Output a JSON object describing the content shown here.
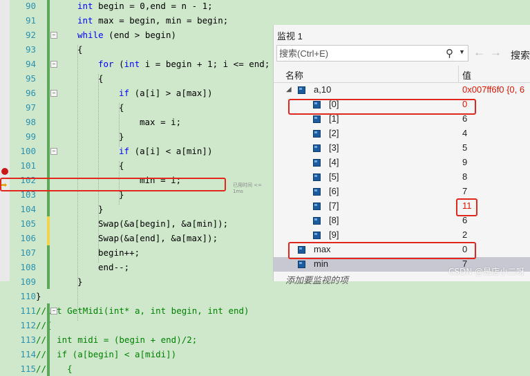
{
  "editor": {
    "lines": [
      {
        "num": "90",
        "parts": [
          [
            "kw",
            "int"
          ],
          [
            "pl",
            " begin = 0,end = n - 1;"
          ]
        ]
      },
      {
        "num": "91",
        "parts": [
          [
            "kw",
            "int"
          ],
          [
            "pl",
            " max = begin, min = begin;"
          ]
        ]
      },
      {
        "num": "92",
        "parts": [
          [
            "kw",
            "while"
          ],
          [
            "pl",
            " (end > begin)"
          ]
        ]
      },
      {
        "num": "93",
        "parts": [
          [
            "pl",
            "{"
          ]
        ]
      },
      {
        "num": "94",
        "parts": [
          [
            "kw",
            "for"
          ],
          [
            "pl",
            " ("
          ],
          [
            "kw",
            "int"
          ],
          [
            "pl",
            " i = begin + 1; i <= end;"
          ]
        ]
      },
      {
        "num": "95",
        "parts": [
          [
            "pl",
            "{"
          ]
        ]
      },
      {
        "num": "96",
        "parts": [
          [
            "kw",
            "if"
          ],
          [
            "pl",
            " (a[i] > a[max])"
          ]
        ]
      },
      {
        "num": "97",
        "parts": [
          [
            "pl",
            "{"
          ]
        ]
      },
      {
        "num": "98",
        "parts": [
          [
            "pl",
            "max = i;"
          ]
        ]
      },
      {
        "num": "99",
        "parts": [
          [
            "pl",
            "}"
          ]
        ]
      },
      {
        "num": "100",
        "parts": [
          [
            "kw",
            "if"
          ],
          [
            "pl",
            " (a[i] < a[min])"
          ]
        ]
      },
      {
        "num": "101",
        "parts": [
          [
            "pl",
            "{"
          ]
        ]
      },
      {
        "num": "102",
        "parts": [
          [
            "pl",
            "min = i;"
          ]
        ]
      },
      {
        "num": "103",
        "parts": [
          [
            "pl",
            "}"
          ]
        ]
      },
      {
        "num": "104",
        "parts": [
          [
            "pl",
            "}"
          ]
        ]
      },
      {
        "num": "105",
        "parts": [
          [
            "pl",
            "Swap(&a[begin], &a[min]);"
          ]
        ]
      },
      {
        "num": "106",
        "parts": [
          [
            "pl",
            "Swap(&a[end], &a[max]);"
          ]
        ]
      },
      {
        "num": "107",
        "parts": [
          [
            "pl",
            "begin++;"
          ]
        ]
      },
      {
        "num": "108",
        "parts": [
          [
            "pl",
            "end--;"
          ]
        ]
      },
      {
        "num": "109",
        "parts": [
          [
            "pl",
            "}"
          ]
        ]
      },
      {
        "num": "110",
        "parts": [
          [
            "pl",
            "}"
          ]
        ]
      },
      {
        "num": "111",
        "parts": [
          [
            "cm",
            "//int GetMidi(int* a, int begin, int end)"
          ]
        ]
      },
      {
        "num": "112",
        "parts": [
          [
            "cm",
            "//{"
          ]
        ]
      },
      {
        "num": "113",
        "parts": [
          [
            "cm",
            "//  int midi = (begin + end)/2;"
          ]
        ]
      },
      {
        "num": "114",
        "parts": [
          [
            "cm",
            "//  if (a[begin] < a[midi])"
          ]
        ]
      },
      {
        "num": "115",
        "parts": [
          [
            "cm",
            "//    {"
          ]
        ]
      }
    ],
    "elapsed_hint": "已用时间 <= 1ms"
  },
  "watch": {
    "title": "监视 1",
    "search_placeholder": "搜索(Ctrl+E)",
    "search_icon": "search-icon",
    "depth_label": "搜索",
    "col_name": "名称",
    "col_value": "值",
    "rows": [
      {
        "name": "a,10",
        "value": "0x007ff6f0 {0, 6",
        "changed": true,
        "expanded": true
      },
      {
        "name": "[0]",
        "value": "0",
        "changed": true
      },
      {
        "name": "[1]",
        "value": "6",
        "changed": false
      },
      {
        "name": "[2]",
        "value": "4",
        "changed": false
      },
      {
        "name": "[3]",
        "value": "5",
        "changed": false
      },
      {
        "name": "[4]",
        "value": "9",
        "changed": false
      },
      {
        "name": "[5]",
        "value": "8",
        "changed": false
      },
      {
        "name": "[6]",
        "value": "7",
        "changed": false
      },
      {
        "name": "[7]",
        "value": "11",
        "changed": true
      },
      {
        "name": "[8]",
        "value": "6",
        "changed": false
      },
      {
        "name": "[9]",
        "value": "2",
        "changed": false
      },
      {
        "name": "max",
        "value": "0",
        "changed": false
      },
      {
        "name": "min",
        "value": "7",
        "changed": false
      }
    ],
    "add_item": "添加要监视的项"
  },
  "watermark": "CSDN @是店小二呀",
  "colors": {
    "keyword": "#0000ff",
    "comment": "#008000",
    "changed_value": "#e51400",
    "annotation": "#e1261c"
  }
}
